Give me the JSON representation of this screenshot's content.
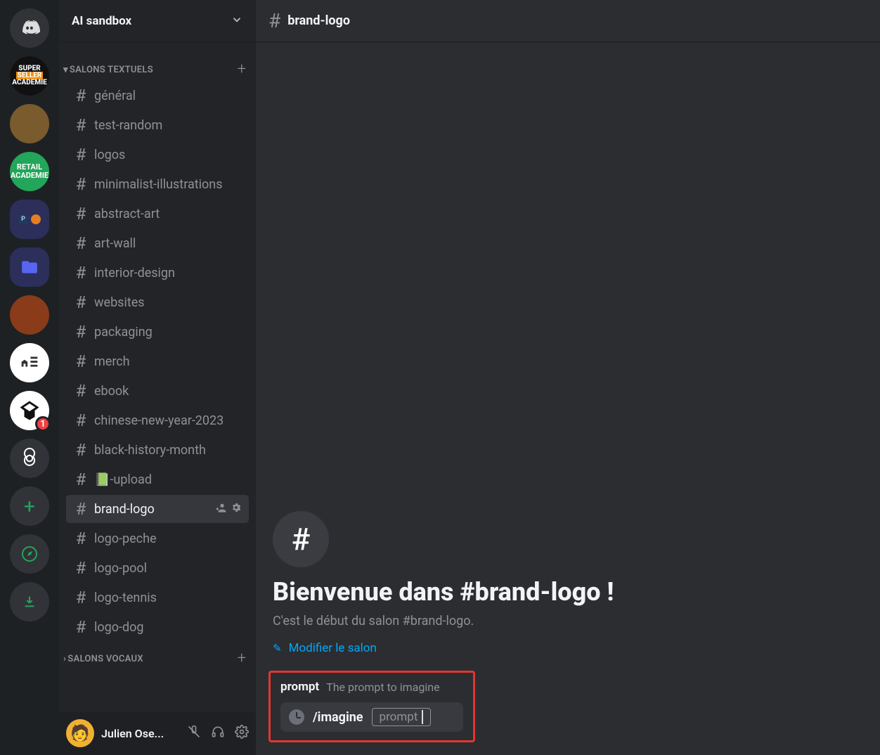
{
  "server": {
    "name": "AI sandbox",
    "badge_count": "1"
  },
  "categories": [
    {
      "label": "SALONS TEXTUELS"
    },
    {
      "label": "SALONS VOCAUX"
    }
  ],
  "channels": [
    "général",
    "test-random",
    "logos",
    "minimalist-illustrations",
    "abstract-art",
    "art-wall",
    "interior-design",
    "websites",
    "packaging",
    "merch",
    "ebook",
    "chinese-new-year-2023",
    "black-history-month",
    "📗-upload",
    "brand-logo",
    "logo-peche",
    "logo-pool",
    "logo-tennis",
    "logo-dog"
  ],
  "active_channel": "brand-logo",
  "header_channel": "brand-logo",
  "user": {
    "name": "Julien Ose..."
  },
  "welcome": {
    "title": "Bienvenue dans #brand-logo !",
    "subtitle": "C'est le début du salon #brand-logo.",
    "edit_label": "Modifier le salon"
  },
  "command": {
    "param_name": "prompt",
    "param_desc": "The prompt to imagine",
    "slash": "/imagine",
    "param_box": "prompt"
  }
}
